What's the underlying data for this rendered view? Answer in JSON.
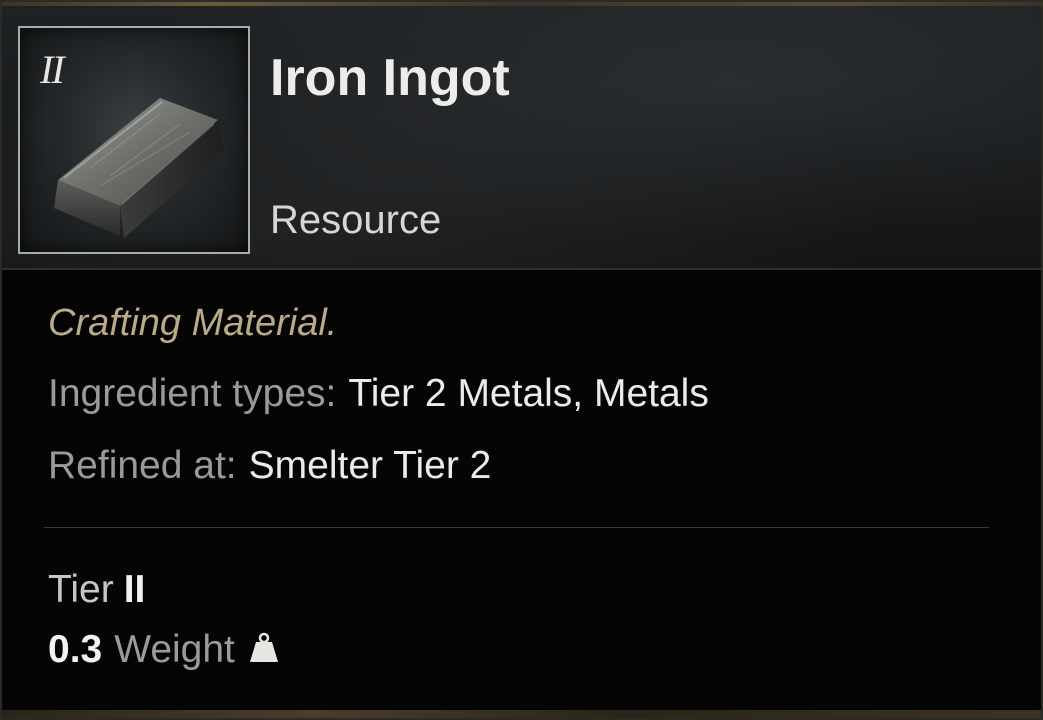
{
  "item": {
    "tier_badge": "II",
    "name": "Iron Ingot",
    "category": "Resource",
    "icon": "iron-ingot-icon"
  },
  "details": {
    "flavor_text": "Crafting Material.",
    "ingredient_label": "Ingredient types:",
    "ingredient_value": "Tier 2 Metals, Metals",
    "refined_label": "Refined at:",
    "refined_value": "Smelter Tier 2"
  },
  "stats": {
    "tier_label": "Tier",
    "tier_value": "II",
    "weight_value": "0.3",
    "weight_label": "Weight",
    "weight_icon": "weight-icon"
  },
  "colors": {
    "flavor": "#b9ab8a",
    "label": "#9a9a96",
    "value": "#ebebe8",
    "background": "#050505"
  }
}
